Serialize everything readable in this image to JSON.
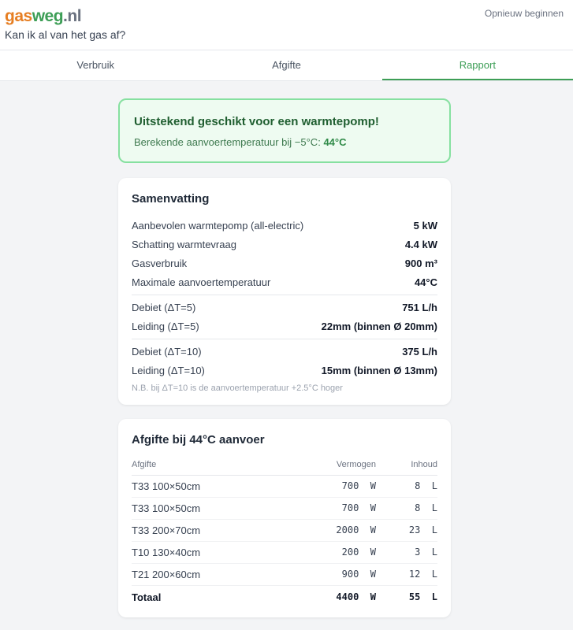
{
  "header": {
    "logo": {
      "part1": "gas",
      "part2": "weg",
      "part3": ".nl"
    },
    "tagline": "Kan ik al van het gas af?",
    "restart_label": "Opnieuw beginnen"
  },
  "tabs": [
    {
      "label": "Verbruik",
      "active": false
    },
    {
      "label": "Afgifte",
      "active": false
    },
    {
      "label": "Rapport",
      "active": true
    }
  ],
  "banner": {
    "title": "Uitstekend geschikt voor een warmtepomp!",
    "subtitle": "Berekende aanvoertemperatuur bij −5°C:",
    "value": "44°C"
  },
  "summary": {
    "title": "Samenvatting",
    "group1": [
      {
        "label": "Aanbevolen warmtepomp (all-electric)",
        "value": "5 kW"
      },
      {
        "label": "Schatting warmtevraag",
        "value": "4.4 kW"
      },
      {
        "label": "Gasverbruik",
        "value": "900 m³"
      },
      {
        "label": "Maximale aanvoertemperatuur",
        "value": "44°C"
      }
    ],
    "group2": [
      {
        "label": "Debiet (ΔT=5)",
        "value": "751 L/h"
      },
      {
        "label": "Leiding (ΔT=5)",
        "value": "22mm (binnen Ø 20mm)"
      }
    ],
    "group3": [
      {
        "label": "Debiet (ΔT=10)",
        "value": "375 L/h"
      },
      {
        "label": "Leiding (ΔT=10)",
        "value": "15mm (binnen Ø 13mm)"
      }
    ],
    "note": "N.B. bij ΔT=10 is de aanvoertemperatuur +2.5°C hoger"
  },
  "emission": {
    "title": "Afgifte bij 44°C aanvoer",
    "headers": {
      "name": "Afgifte",
      "power": "Vermogen",
      "content": "Inhoud"
    },
    "rows": [
      {
        "name": "T33 100×50cm",
        "power": "700  W",
        "content": "8  L"
      },
      {
        "name": "T33 100×50cm",
        "power": "700  W",
        "content": "8  L"
      },
      {
        "name": "T33 200×70cm",
        "power": "2000  W",
        "content": "23  L"
      },
      {
        "name": "T10 130×40cm",
        "power": "200  W",
        "content": "3  L"
      },
      {
        "name": "T21 200×60cm",
        "power": "900  W",
        "content": "12  L"
      }
    ],
    "total": {
      "name": "Totaal",
      "power": "4400  W",
      "content": "55  L"
    }
  }
}
